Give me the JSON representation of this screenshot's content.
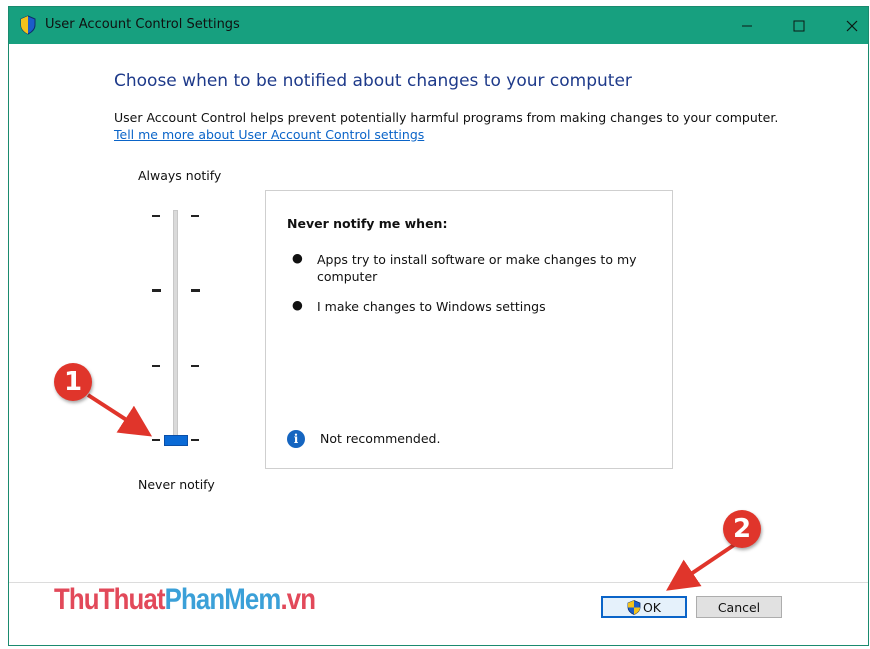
{
  "window": {
    "title": "User Account Control Settings",
    "title_icon": "uac-shield-icon",
    "controls": [
      "minimize-icon",
      "maximize-icon",
      "close-icon"
    ]
  },
  "main": {
    "heading": "Choose when to be notified about changes to your computer",
    "description": "User Account Control helps prevent potentially harmful programs from making changes to your computer.",
    "link": "Tell me more about User Account Control settings"
  },
  "slider": {
    "top_label": "Always notify",
    "bottom_label": "Never notify",
    "levels": 4,
    "selected_level": 0
  },
  "info": {
    "title": "Never notify me when:",
    "bullets": [
      "Apps try to install software or make changes to my computer",
      "I make changes to Windows settings"
    ],
    "note": "Not recommended.",
    "note_icon": "info-icon"
  },
  "buttons": {
    "ok": "OK",
    "cancel": "Cancel"
  },
  "annotations": {
    "step1": "1",
    "step2": "2"
  },
  "watermark": {
    "part1": "ThuThuat",
    "part2": "PhanMem",
    "part3": ".vn"
  },
  "colors": {
    "titlebar": "#17a07f",
    "heading": "#1e3a8a",
    "link": "#0a64c8",
    "thumb": "#0a6ad6",
    "badge": "#e0352b"
  }
}
